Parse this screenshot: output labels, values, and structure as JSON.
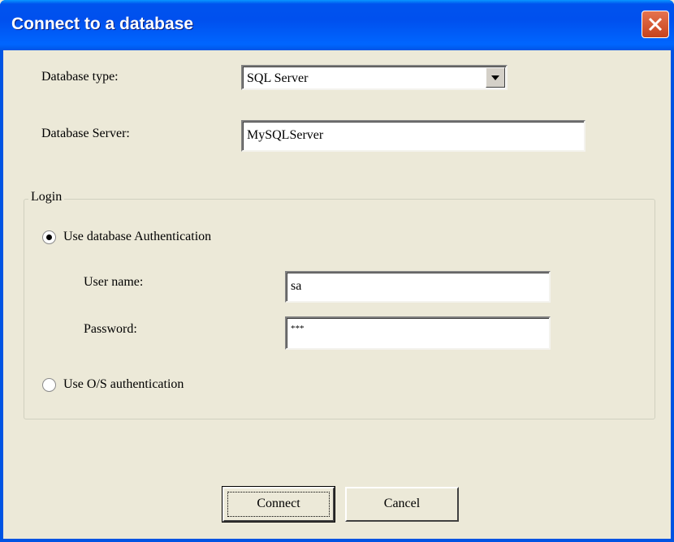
{
  "window": {
    "title": "Connect to a database"
  },
  "form": {
    "db_type_label": "Database type:",
    "db_type_value": "SQL Server",
    "db_server_label": "Database Server:",
    "db_server_value": "MySQLServer"
  },
  "login": {
    "group_label": "Login",
    "db_auth_label": "Use database Authentication",
    "db_auth_selected": true,
    "username_label": "User name:",
    "username_value": "sa",
    "password_label": "Password:",
    "password_value": "***",
    "os_auth_label": "Use O/S authentication",
    "os_auth_selected": false
  },
  "buttons": {
    "connect": "Connect",
    "cancel": "Cancel"
  }
}
